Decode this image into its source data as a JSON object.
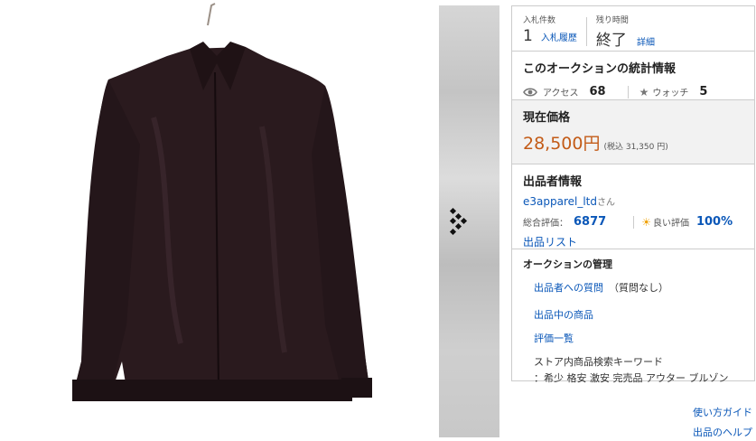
{
  "bids": {
    "label": "入札件数",
    "count": "1",
    "history_link": "入札履歴"
  },
  "time_left": {
    "label": "残り時間",
    "value": "終了",
    "detail_link": "詳細"
  },
  "stats": {
    "title": "このオークションの統計情報",
    "access_label": "アクセス",
    "access_count": "68",
    "watch_label": "ウォッチ",
    "watch_count": "5"
  },
  "price": {
    "label": "現在価格",
    "value": "28,500円",
    "tax": "(税込 31,350 円)"
  },
  "seller": {
    "title": "出品者情報",
    "name": "e3apparel_ltd",
    "suffix": "さん",
    "rating_label": "総合評価：",
    "rating_value": "6877",
    "good_label": "良い評価",
    "good_value": "100%",
    "list_link": "出品リスト"
  },
  "management": {
    "title": "オークションの管理",
    "question_link": "出品者への質問",
    "question_note": "（質問なし）",
    "listing_link": "出品中の商品",
    "review_link": "評価一覧",
    "keyword_label": "ストア内商品検索キーワード",
    "keywords": "：希少 格安 激安 完売品 アウター ブルゾン"
  },
  "footer": {
    "guide_link": "使い方ガイド",
    "help_link": "出品のヘルプ"
  },
  "colors": {
    "price": "#c35b17",
    "link": "#0a57b8",
    "jacket": "#2a1a1e"
  }
}
